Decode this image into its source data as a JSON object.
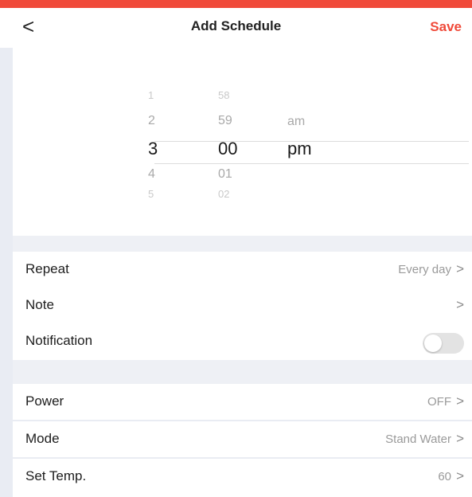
{
  "header": {
    "back_icon": "chevron-left-icon",
    "back_glyph": "<",
    "title": "Add Schedule",
    "save_label": "Save"
  },
  "time_picker": {
    "hours": [
      "1",
      "2",
      "3",
      "4",
      "5"
    ],
    "minutes": [
      "58",
      "59",
      "00",
      "01",
      "02"
    ],
    "periods": [
      "am",
      "pm"
    ],
    "selected_hour": "3",
    "selected_minute": "00",
    "selected_period": "pm"
  },
  "settings": {
    "repeat": {
      "label": "Repeat",
      "value": "Every day"
    },
    "note": {
      "label": "Note",
      "value": ""
    },
    "notification": {
      "label": "Notification",
      "enabled": false
    }
  },
  "device": {
    "power": {
      "label": "Power",
      "value": "OFF"
    },
    "mode": {
      "label": "Mode",
      "value": "Stand Water"
    },
    "temp": {
      "label": "Set Temp.",
      "value": "60"
    }
  },
  "chevron": ">",
  "colors": {
    "accent": "#f04a3a",
    "background": "#e9ecf3",
    "surface": "#ffffff"
  }
}
